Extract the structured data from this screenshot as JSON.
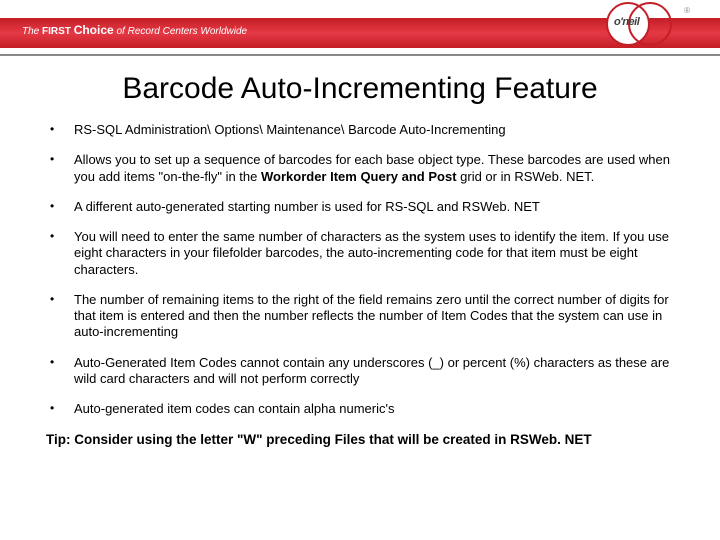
{
  "header": {
    "tagline_pre": "The",
    "tagline_first": "FIRST",
    "tagline_choice": "Choice",
    "tagline_post": "of Record Centers Worldwide",
    "logo_text": "o'neil",
    "reg": "®"
  },
  "title": "Barcode Auto-Incrementing Feature",
  "bullets": [
    {
      "html": "RS-SQL Administration\\ Options\\ Maintenance\\ Barcode Auto-Incrementing"
    },
    {
      "html": "Allows you to set up a sequence of barcodes for each base object type. These barcodes are used when you add items \"on-the-fly\" in the <span class='b'>Workorder Item Query and Post</span> grid or in RSWeb. NET."
    },
    {
      "html": "A different auto-generated starting number is used for RS-SQL and RSWeb. NET"
    },
    {
      "html": "You will need to enter the same number of characters as the system uses to identify the item. If you use eight characters in your filefolder barcodes, the auto-incrementing code for that item must be eight characters."
    },
    {
      "html": "The number of remaining items to the right of the field remains zero until the correct number of digits for that item is entered and then the number reflects the number of Item Codes that the system can use in auto-incrementing"
    },
    {
      "html": "Auto-Generated Item Codes cannot contain any underscores (_) or percent (%) characters as these are wild card characters and will not perform correctly"
    },
    {
      "html": "Auto-generated item codes can contain alpha numeric's"
    }
  ],
  "tip": "Tip: Consider using the letter \"W\" preceding Files that will be created in RSWeb. NET"
}
